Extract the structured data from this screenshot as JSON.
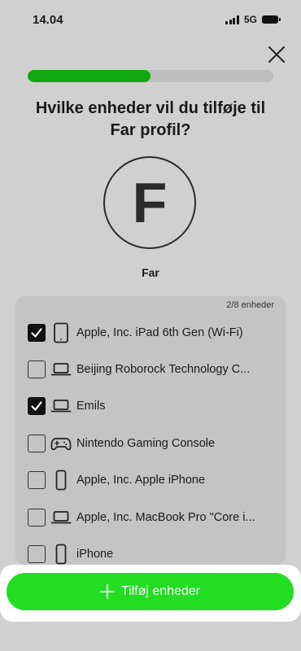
{
  "status": {
    "time": "14.04",
    "network": "5G"
  },
  "progress": {
    "fraction": 0.5
  },
  "title": {
    "line1": "Hvilke enheder vil du tilføje til",
    "line2": "Far profil?"
  },
  "profile": {
    "initial": "F",
    "name": "Far"
  },
  "devices_header": {
    "count": "2/8 enheder"
  },
  "devices": [
    {
      "name": "Apple, Inc. iPad 6th Gen (Wi-Fi)",
      "icon": "tablet-icon",
      "checked": true
    },
    {
      "name": "Beijing Roborock Technology C...",
      "icon": "laptop-icon",
      "checked": false
    },
    {
      "name": "Emils",
      "icon": "laptop-icon",
      "checked": true
    },
    {
      "name": "Nintendo Gaming Console",
      "icon": "gamepad-icon",
      "checked": false
    },
    {
      "name": "Apple, Inc. Apple iPhone",
      "icon": "phone-icon",
      "checked": false
    },
    {
      "name": "Apple, Inc. MacBook Pro \"Core i...",
      "icon": "laptop-icon",
      "checked": false
    },
    {
      "name": "iPhone",
      "icon": "phone-icon",
      "checked": false
    }
  ],
  "actions": {
    "add_label": "Tilføj enheder"
  },
  "colors": {
    "accent": "#22dd22",
    "progress": "#11a811"
  }
}
